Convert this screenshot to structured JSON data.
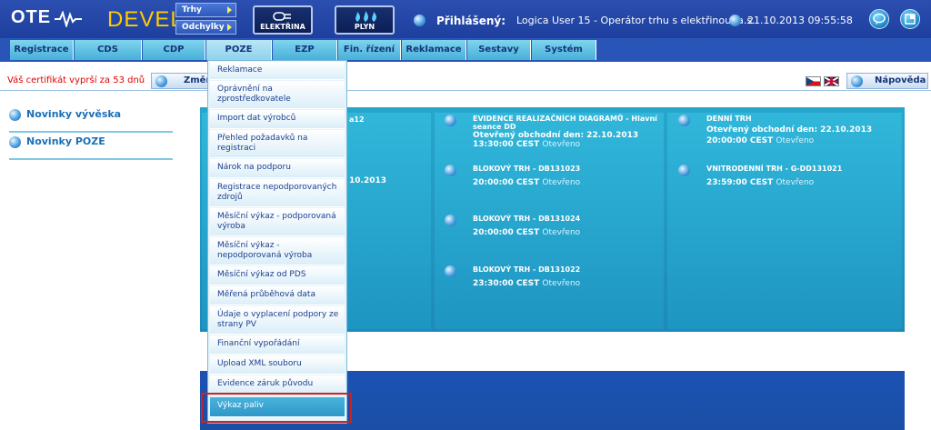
{
  "header": {
    "logo_text": "OTE",
    "env_label": "DEVEL",
    "trhy_label": "Trhy",
    "odchylky_label": "Odchylky",
    "elektrina_label": "ELEKTŘINA",
    "plyn_label": "PLYN",
    "login_label": "Přihlášený:",
    "login_user": "Logica User 15 - Operátor trhu s elektřinou, a.s.",
    "clock": "21.10.2013 09:55:58"
  },
  "nav": {
    "tabs": [
      "Registrace",
      "CDS",
      "CDP",
      "POZE",
      "EZP",
      "Fin. řízení",
      "Reklamace",
      "Sestavy",
      "Systém"
    ],
    "active": "POZE"
  },
  "toolbar": {
    "cert_message": "Váš certifikát vyprší za 53 dnů",
    "change_label": "Změn",
    "help_label": "Nápověda"
  },
  "sidebar": {
    "items": [
      "Novinky vývěska",
      "Novinky POZE"
    ]
  },
  "dropdown": {
    "items": [
      "Reklamace",
      "Oprávnění na zprostředkovatele",
      "Import dat výrobců",
      "Přehled požadavků na registraci",
      "Nárok na podporu",
      "Registrace nepodporovaných zdrojů",
      "Měsíční výkaz - podporovaná výroba",
      "Měsíční výkaz - nepodporovaná výroba",
      "Měsíční výkaz od PDS",
      "Měřená průběhová data",
      "Údaje o vyplacení podpory ze strany PV",
      "Finanční vypořádání",
      "Upload XML souboru",
      "Evidence záruk původu",
      "Výkaz paliv"
    ],
    "highlighted": "Výkaz paliv"
  },
  "panel": {
    "col1": {
      "partial_top": "a12",
      "partial_mid": "10.2013"
    },
    "col2": [
      {
        "title": "EVIDENCE REALIZAČNÍCH DIAGRAMŮ - Hlavní seance DD",
        "sub": "Otevřený obchodní den: 22.10.2013",
        "time": "13:30:00 CEST",
        "status": "Otevřeno"
      },
      {
        "title": "BLOKOVÝ TRH - DB131023",
        "time": "20:00:00 CEST",
        "status": "Otevřeno"
      },
      {
        "title": "BLOKOVÝ TRH - DB131024",
        "time": "20:00:00 CEST",
        "status": "Otevřeno"
      },
      {
        "title": "BLOKOVÝ TRH - DB131022",
        "time": "23:30:00 CEST",
        "status": "Otevřeno"
      }
    ],
    "col3": [
      {
        "title": "DENNÍ TRH",
        "sub": "Otevřený obchodní den: 22.10.2013",
        "time": "20:00:00 CEST",
        "status": "Otevřeno"
      },
      {
        "title": "VNITRODENNÍ TRH - G-DD131021",
        "time": "23:59:00 CEST",
        "status": "Otevřeno"
      }
    ]
  },
  "icons": [
    "wave-logo-icon",
    "plug-icon",
    "gas-flame-icon",
    "chat-icon",
    "window-icon",
    "flag-cz-icon",
    "flag-uk-icon"
  ],
  "colors": {
    "header": "#1e3f9e",
    "accent": "#ffcc00",
    "panel": "#1d8ab8",
    "cert_warning": "#e00000",
    "highlight_box": "#d02020"
  }
}
